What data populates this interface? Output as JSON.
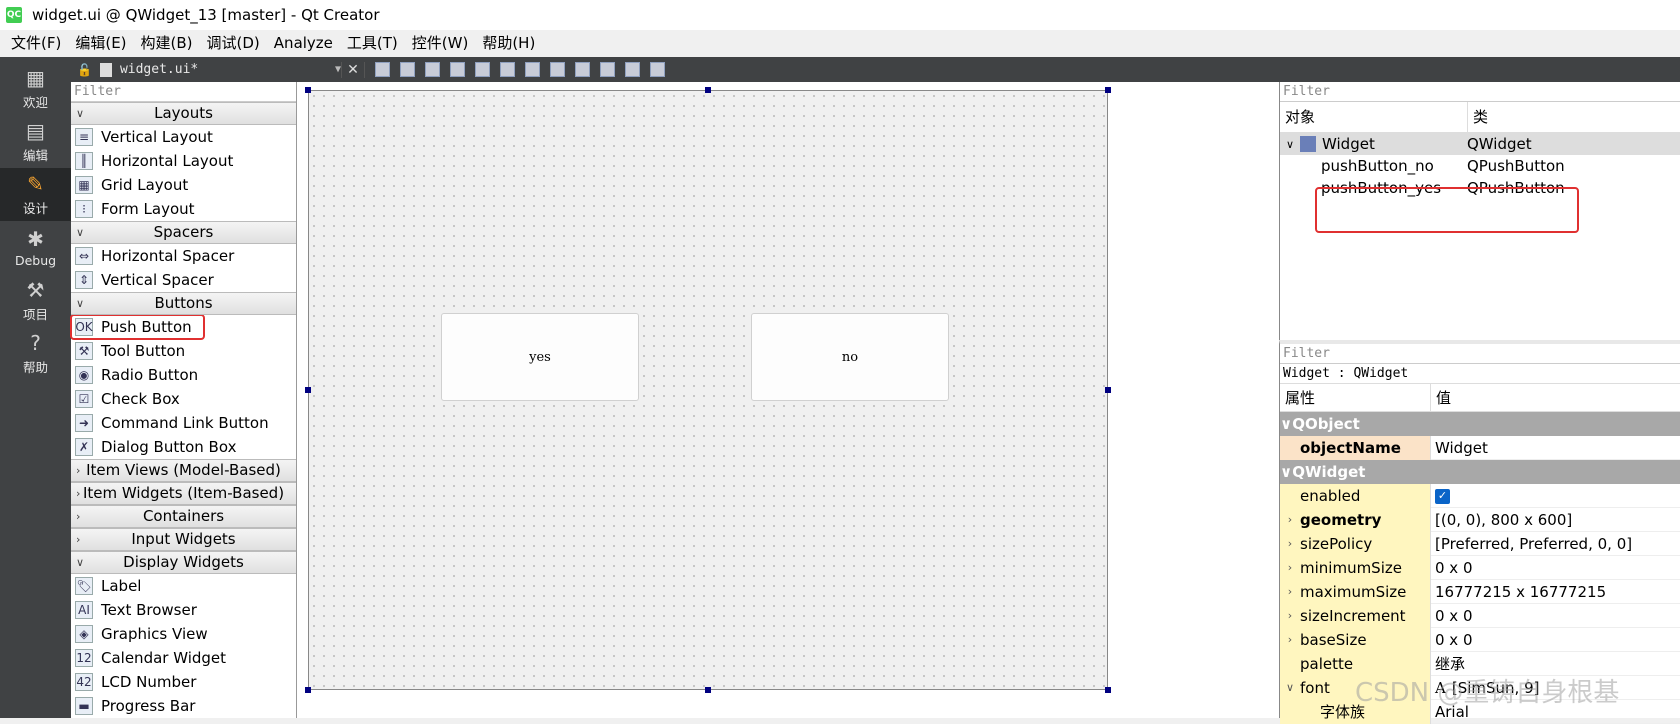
{
  "window": {
    "title": "widget.ui @ QWidget_13 [master] - Qt Creator",
    "logo": "QC"
  },
  "menubar": [
    "文件(F)",
    "编辑(E)",
    "构建(B)",
    "调试(D)",
    "Analyze",
    "工具(T)",
    "控件(W)",
    "帮助(H)"
  ],
  "modes": [
    {
      "label": "欢迎",
      "icon": "grid-icon"
    },
    {
      "label": "编辑",
      "icon": "edit-doc-icon"
    },
    {
      "label": "设计",
      "icon": "pencil-icon",
      "active": true
    },
    {
      "label": "Debug",
      "icon": "bug-icon"
    },
    {
      "label": "项目",
      "icon": "wrench-icon"
    },
    {
      "label": "帮助",
      "icon": "help-icon"
    }
  ],
  "toolbar": {
    "document": "widget.ui*",
    "close": "✕"
  },
  "widgetbox": {
    "filter_placeholder": "Filter",
    "categories": {
      "layouts": "Layouts",
      "spacers": "Spacers",
      "buttons": "Buttons",
      "item_views": "Item Views (Model-Based)",
      "item_widgets": "Item Widgets (Item-Based)",
      "containers": "Containers",
      "input_widgets": "Input Widgets",
      "display_widgets": "Display Widgets"
    },
    "layouts": [
      "Vertical Layout",
      "Horizontal Layout",
      "Grid Layout",
      "Form Layout"
    ],
    "spacers": [
      "Horizontal Spacer",
      "Vertical Spacer"
    ],
    "buttons": [
      "Push Button",
      "Tool Button",
      "Radio Button",
      "Check Box",
      "Command Link Button",
      "Dialog Button Box"
    ],
    "display": [
      "Label",
      "Text Browser",
      "Graphics View",
      "Calendar Widget",
      "LCD Number",
      "Progress Bar"
    ]
  },
  "form": {
    "yes_label": "yes",
    "no_label": "no"
  },
  "object_inspector": {
    "filter_placeholder": "Filter",
    "col_object": "对象",
    "col_class": "类",
    "rows": [
      {
        "name": "Widget",
        "class": "QWidget"
      },
      {
        "name": "pushButton_no",
        "class": "QPushButton"
      },
      {
        "name": "pushButton_yes",
        "class": "QPushButton"
      }
    ]
  },
  "property_editor": {
    "filter_placeholder": "Filter",
    "subtitle": "Widget : QWidget",
    "col_prop": "属性",
    "col_value": "值",
    "group_qobject": "QObject",
    "objectName": {
      "name": "objectName",
      "value": "Widget"
    },
    "group_qwidget": "QWidget",
    "props": [
      {
        "name": "enabled",
        "value": ""
      },
      {
        "name": "geometry",
        "value": "[(0, 0), 800 x 600]"
      },
      {
        "name": "sizePolicy",
        "value": "[Preferred, Preferred, 0, 0]"
      },
      {
        "name": "minimumSize",
        "value": "0 x 0"
      },
      {
        "name": "maximumSize",
        "value": "16777215 x 16777215"
      },
      {
        "name": "sizeIncrement",
        "value": "0 x 0"
      },
      {
        "name": "baseSize",
        "value": "0 x 0"
      },
      {
        "name": "palette",
        "value": "继承"
      },
      {
        "name": "font",
        "value": "[SimSun, 9]"
      },
      {
        "name": "字体族",
        "value": "Arial"
      }
    ]
  },
  "watermark": "CSDN @重铸自身根基"
}
